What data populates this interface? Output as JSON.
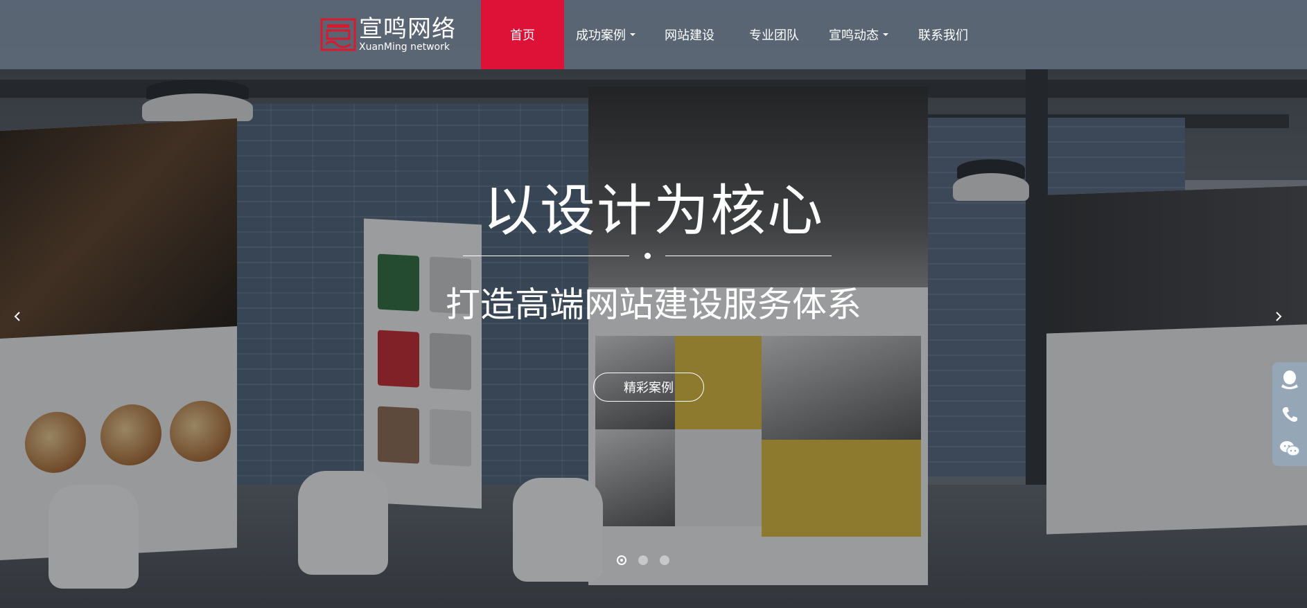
{
  "brand": {
    "logo_cn": "宣鸣网络",
    "logo_en": "XuanMing network",
    "accent": "#dd1236"
  },
  "nav": {
    "items": [
      {
        "label": "首页",
        "active": true,
        "dropdown": false
      },
      {
        "label": "成功案例",
        "active": false,
        "dropdown": true
      },
      {
        "label": "网站建设",
        "active": false,
        "dropdown": false
      },
      {
        "label": "专业团队",
        "active": false,
        "dropdown": false
      },
      {
        "label": "宣鸣动态",
        "active": false,
        "dropdown": true
      },
      {
        "label": "联系我们",
        "active": false,
        "dropdown": false
      }
    ]
  },
  "hero": {
    "headline": "以设计为核心",
    "subline": "打造高端网站建设服务体系",
    "cta_label": "精彩案例",
    "slide_count": 3,
    "active_slide": 1
  },
  "side_contact": {
    "icons": [
      "qq-icon",
      "phone-icon",
      "wechat-icon"
    ]
  }
}
